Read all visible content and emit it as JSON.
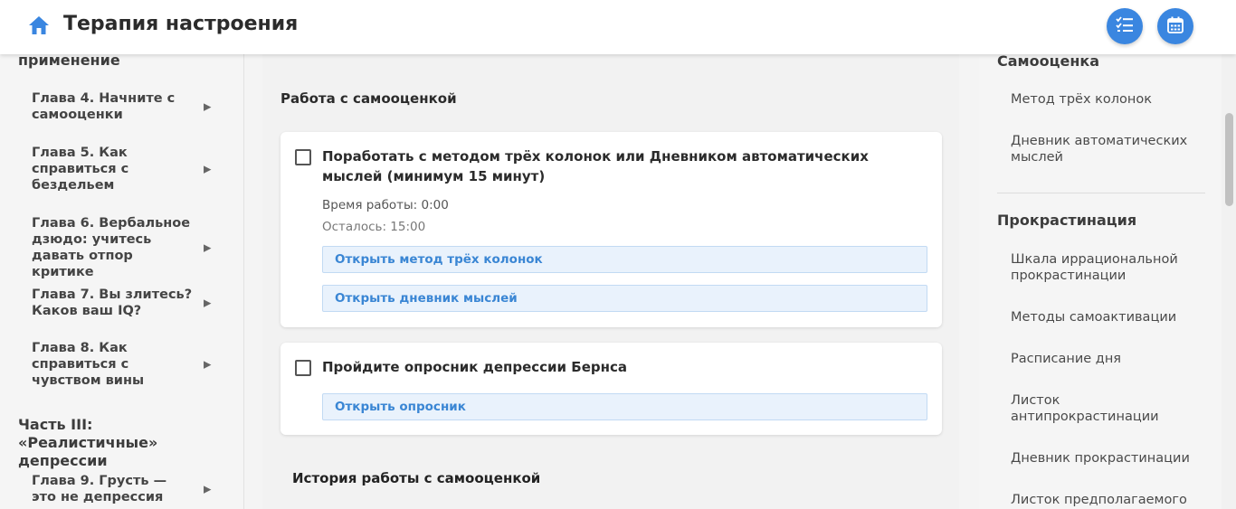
{
  "header": {
    "title": "Терапия настроения",
    "home_icon": "home-icon",
    "buttons": [
      {
        "icon": "checklist-icon"
      },
      {
        "icon": "calendar-icon"
      }
    ],
    "accent_color": "#3a86e0"
  },
  "left_sidebar": {
    "part_top": "применение",
    "chapters": [
      {
        "label": "Глава 4. Начните с самооценки"
      },
      {
        "label": "Глава 5. Как справиться с бездельем"
      },
      {
        "label": "Глава 6. Вербальное дзюдо: учитесь давать отпор критике"
      },
      {
        "label": "Глава 7. Вы злитесь? Каков ваш IQ?"
      },
      {
        "label": "Глава 8. Как справиться с чувством вины"
      }
    ],
    "part3": "Часть III: «Реалистичные» депрессии",
    "chapter9": "Глава 9. Грусть — это не депрессия",
    "arrow": "▶"
  },
  "main": {
    "section_title": "Работа с самооценкой",
    "task1": {
      "title": "Поработать с методом трёх колонок или Дневником автоматических мыслей (минимум 15 минут)",
      "time_worked": "Время работы: 0:00",
      "remaining": "Осталось: 15:00",
      "btn1": "Открыть метод трёх колонок",
      "btn2": "Открыть дневник мыслей"
    },
    "task2": {
      "title": "Пройдите опросник депрессии Бернса",
      "btn": "Открыть опросник"
    },
    "history_title": "История работы с самооценкой"
  },
  "right_sidebar": {
    "sec1_title": "Самооценка",
    "sec1_items": [
      "Метод трёх колонок",
      "Дневник автоматических мыслей"
    ],
    "sec2_title": "Прокрастинация",
    "sec2_items": [
      "Шкала иррациональной прокрастинации",
      "Методы самоактивации",
      "Расписание дня",
      "Листок антипрокрастинации",
      "Дневник прокрастинации",
      "Листок предполагаемого"
    ]
  }
}
